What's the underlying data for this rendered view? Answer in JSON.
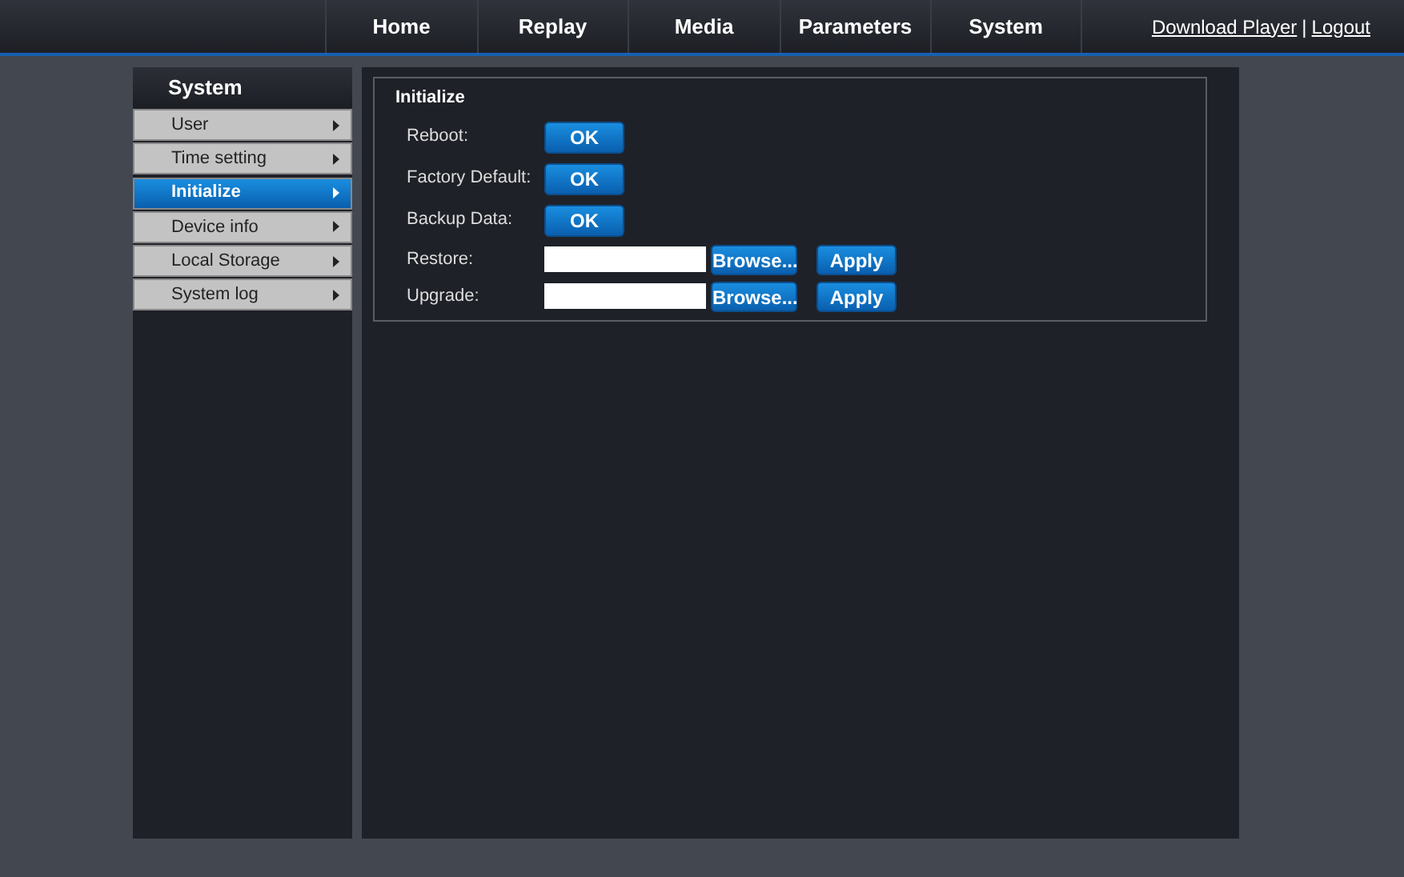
{
  "nav": [
    {
      "label": "Home",
      "selected": false
    },
    {
      "label": "Replay",
      "selected": false
    },
    {
      "label": "Media",
      "selected": false
    },
    {
      "label": "Parameters",
      "selected": false
    },
    {
      "label": "System",
      "selected": false
    }
  ],
  "links": [
    "Download Player",
    "|",
    "Logout"
  ],
  "sidebar": {
    "title": "System",
    "items": [
      {
        "label": "User",
        "selected": false
      },
      {
        "label": "Time setting",
        "selected": false
      },
      {
        "label": "Initialize",
        "selected": true
      },
      {
        "label": "Device info",
        "selected": false
      },
      {
        "label": "Local Storage",
        "selected": false
      },
      {
        "label": "System log",
        "selected": false
      }
    ]
  },
  "panel": {
    "title": "Initialize",
    "rows": [
      {
        "kind": "ok",
        "label": "Reboot:",
        "button": "OK"
      },
      {
        "kind": "ok",
        "label": "Factory Default:",
        "button": "OK"
      },
      {
        "kind": "ok",
        "label": "Backup Data:",
        "button": "OK"
      },
      {
        "kind": "file",
        "label": "Restore:",
        "browse": "Browse...",
        "apply": "Apply"
      },
      {
        "kind": "file",
        "label": "Upgrade:",
        "browse": "Browse...",
        "apply": "Apply"
      }
    ]
  }
}
